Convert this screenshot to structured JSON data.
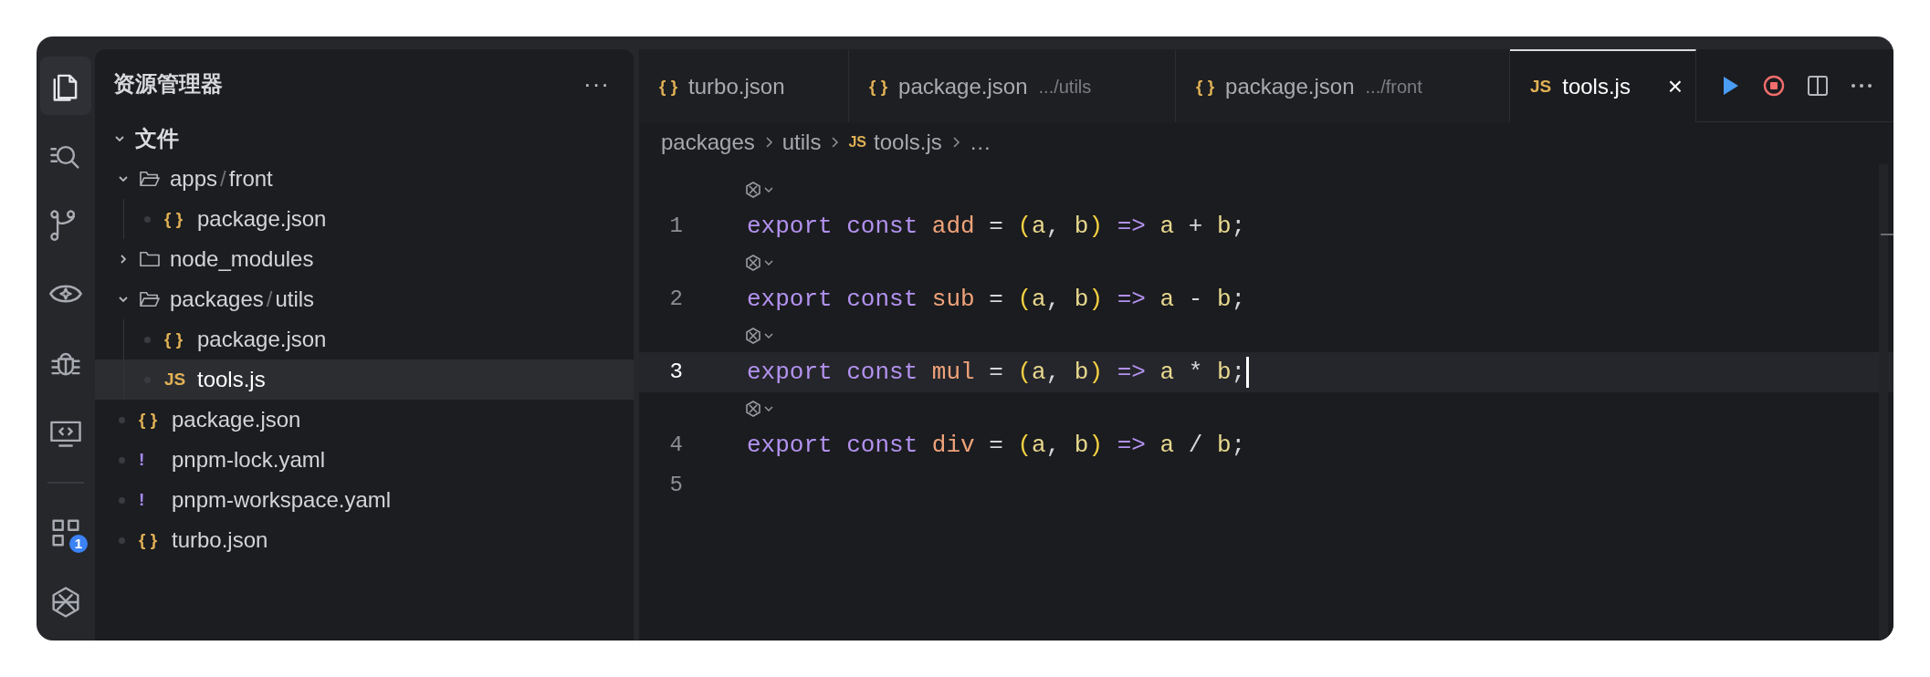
{
  "activity_bar": {
    "items": [
      {
        "kind": "files",
        "selected": true
      },
      {
        "kind": "search",
        "selected": false
      },
      {
        "kind": "branch",
        "selected": false
      },
      {
        "kind": "eye",
        "selected": false
      },
      {
        "kind": "bug",
        "selected": false
      },
      {
        "kind": "remote",
        "selected": false
      },
      {
        "kind": "extensions",
        "selected": false,
        "badge": "1"
      },
      {
        "kind": "logo",
        "selected": false
      }
    ]
  },
  "sidebar": {
    "title": "资源管理器",
    "more": "···",
    "section": {
      "label": "文件",
      "expanded": true,
      "tree": [
        {
          "kind": "folder",
          "label_parts": [
            "apps",
            "/",
            "front"
          ],
          "expanded": true,
          "selected": false,
          "children": [
            {
              "kind": "file",
              "icon": "{ }",
              "color": "#e0b155",
              "label": "package.json",
              "selected": false
            }
          ]
        },
        {
          "kind": "folder",
          "label_parts": [
            "node_modules"
          ],
          "expanded": false,
          "selected": false
        },
        {
          "kind": "folder",
          "label_parts": [
            "packages",
            "/",
            "utils"
          ],
          "expanded": true,
          "selected": false,
          "children": [
            {
              "kind": "file",
              "icon": "{ }",
              "color": "#e0b155",
              "label": "package.json",
              "selected": false
            },
            {
              "kind": "file",
              "icon": "JS",
              "color": "#e0b155",
              "label": "tools.js",
              "selected": true
            }
          ]
        },
        {
          "kind": "file",
          "icon": "{ }",
          "color": "#e0b155",
          "label": "package.json",
          "selected": false
        },
        {
          "kind": "file",
          "icon": "!",
          "color": "#a78bfa",
          "label": "pnpm-lock.yaml",
          "selected": false
        },
        {
          "kind": "file",
          "icon": "!",
          "color": "#a78bfa",
          "label": "pnpm-workspace.yaml",
          "selected": false
        },
        {
          "kind": "file",
          "icon": "{ }",
          "color": "#e0b155",
          "label": "turbo.json",
          "selected": false
        }
      ]
    }
  },
  "tabs": [
    {
      "icon": "{ }",
      "label": "turbo.json",
      "selected": false
    },
    {
      "icon": "{ }",
      "label": "package.json",
      "detail": ".../utils",
      "selected": false
    },
    {
      "icon": "{ }",
      "label": "package.json",
      "detail": ".../front",
      "selected": false
    },
    {
      "icon": "JS",
      "label": "tools.js",
      "selected": true,
      "close": "×"
    }
  ],
  "toolbar": [
    {
      "kind": "run"
    },
    {
      "kind": "stop"
    },
    {
      "kind": "split"
    },
    {
      "kind": "more"
    }
  ],
  "breadcrumb": [
    {
      "label": "packages"
    },
    {
      "label": "utils"
    },
    {
      "label": "tools.js",
      "icon": "JS"
    },
    {
      "label": "…"
    }
  ],
  "code": [
    {
      "number": "1",
      "codelens": true,
      "current": false,
      "tokens": [
        {
          "text": "export",
          "kind": "keyword"
        },
        {
          "text": "const",
          "kind": "keyword"
        },
        {
          "text": "add",
          "kind": "name"
        },
        {
          "text": "=",
          "kind": "op"
        },
        {
          "text": "(",
          "kind": "paren"
        },
        {
          "text": "a",
          "kind": "param"
        },
        {
          "text": ",",
          "kind": "op"
        },
        {
          "text": "b",
          "kind": "param"
        },
        {
          "text": ")",
          "kind": "paren"
        },
        {
          "text": "=>",
          "kind": "keyword"
        },
        {
          "text": "a",
          "kind": "param"
        },
        {
          "text": "+",
          "kind": "op"
        },
        {
          "text": "b",
          "kind": "param"
        },
        {
          "text": ";",
          "kind": "op"
        }
      ]
    },
    {
      "number": "2",
      "codelens": true,
      "current": false,
      "tokens": [
        {
          "text": "export",
          "kind": "keyword"
        },
        {
          "text": "const",
          "kind": "keyword"
        },
        {
          "text": "sub",
          "kind": "name"
        },
        {
          "text": "=",
          "kind": "op"
        },
        {
          "text": "(",
          "kind": "paren"
        },
        {
          "text": "a",
          "kind": "param"
        },
        {
          "text": ",",
          "kind": "op"
        },
        {
          "text": "b",
          "kind": "param"
        },
        {
          "text": ")",
          "kind": "paren"
        },
        {
          "text": "=>",
          "kind": "keyword"
        },
        {
          "text": "a",
          "kind": "param"
        },
        {
          "text": "-",
          "kind": "op"
        },
        {
          "text": "b",
          "kind": "param"
        },
        {
          "text": ";",
          "kind": "op"
        }
      ]
    },
    {
      "number": "3",
      "codelens": true,
      "current": true,
      "tokens": [
        {
          "text": "export",
          "kind": "keyword"
        },
        {
          "text": "const",
          "kind": "keyword"
        },
        {
          "text": "mul",
          "kind": "name"
        },
        {
          "text": "=",
          "kind": "op"
        },
        {
          "text": "(",
          "kind": "paren"
        },
        {
          "text": "a",
          "kind": "param"
        },
        {
          "text": ",",
          "kind": "op"
        },
        {
          "text": "b",
          "kind": "param"
        },
        {
          "text": ")",
          "kind": "paren"
        },
        {
          "text": "=>",
          "kind": "keyword"
        },
        {
          "text": "a",
          "kind": "param"
        },
        {
          "text": "*",
          "kind": "op"
        },
        {
          "text": "b",
          "kind": "param"
        },
        {
          "text": ";",
          "kind": "op"
        }
      ]
    },
    {
      "number": "4",
      "codelens": true,
      "current": false,
      "tokens": [
        {
          "text": "export",
          "kind": "keyword"
        },
        {
          "text": "const",
          "kind": "keyword"
        },
        {
          "text": "div",
          "kind": "name"
        },
        {
          "text": "=",
          "kind": "op"
        },
        {
          "text": "(",
          "kind": "paren"
        },
        {
          "text": "a",
          "kind": "param"
        },
        {
          "text": ",",
          "kind": "op"
        },
        {
          "text": "b",
          "kind": "param"
        },
        {
          "text": ")",
          "kind": "paren"
        },
        {
          "text": "=>",
          "kind": "keyword"
        },
        {
          "text": "a",
          "kind": "param"
        },
        {
          "text": "/",
          "kind": "op"
        },
        {
          "text": "b",
          "kind": "param"
        },
        {
          "text": ";",
          "kind": "op"
        }
      ]
    },
    {
      "number": "5",
      "codelens": false,
      "current": false
    }
  ]
}
